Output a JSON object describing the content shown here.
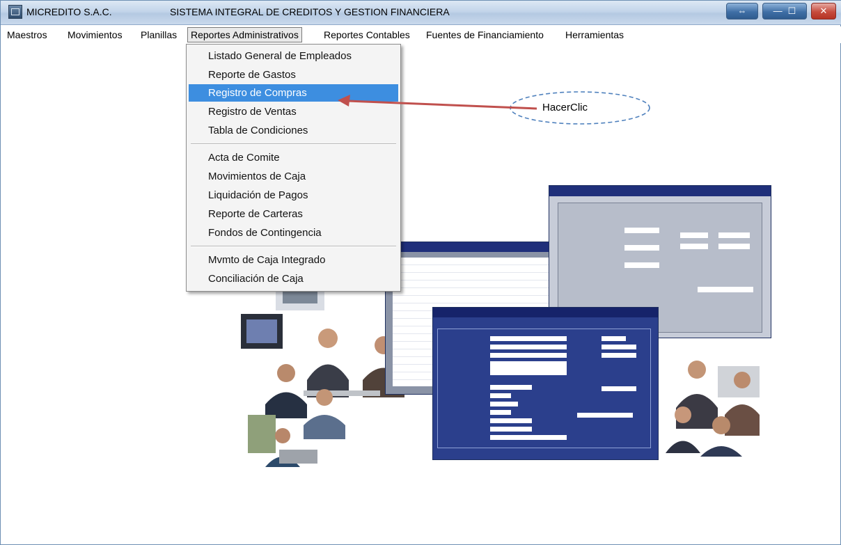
{
  "window": {
    "app_name": "MICREDITO S.A.C.",
    "system_title": "SISTEMA INTEGRAL DE CREDITOS Y GESTION FINANCIERA",
    "controls": {
      "switch_glyph": "⇔",
      "minimize_glyph": "—",
      "maximize_glyph": "☐",
      "close_glyph": "✕"
    }
  },
  "menubar": {
    "items": [
      {
        "label": "Maestros"
      },
      {
        "label": "Movimientos"
      },
      {
        "label": "Planillas"
      },
      {
        "label": "Reportes Administrativos"
      },
      {
        "label": "Reportes Contables"
      },
      {
        "label": "Fuentes de Financiamiento"
      },
      {
        "label": "Herramientas"
      }
    ],
    "active_item": "Reportes Administrativos"
  },
  "dropdown": {
    "groups": [
      [
        "Listado General de Empleados",
        "Reporte de Gastos",
        "Registro de Compras",
        "Registro de Ventas",
        "Tabla de Condiciones"
      ],
      [
        "Acta de Comite",
        "Movimientos de Caja",
        "Liquidación de Pagos",
        "Reporte de Carteras",
        "Fondos de Contingencia"
      ],
      [
        "Mvmto de Caja Integrado",
        "Conciliación de Caja"
      ]
    ],
    "highlighted": "Registro de Compras"
  },
  "annotation": {
    "callout_text": "HacerClic"
  },
  "colors": {
    "titlebar": "#c3d5ea",
    "menu_highlight": "#3d8ee0",
    "arrow": "#c0504d",
    "callout_border": "#4f81bd",
    "screenshot_window": "#2b3f8c"
  }
}
